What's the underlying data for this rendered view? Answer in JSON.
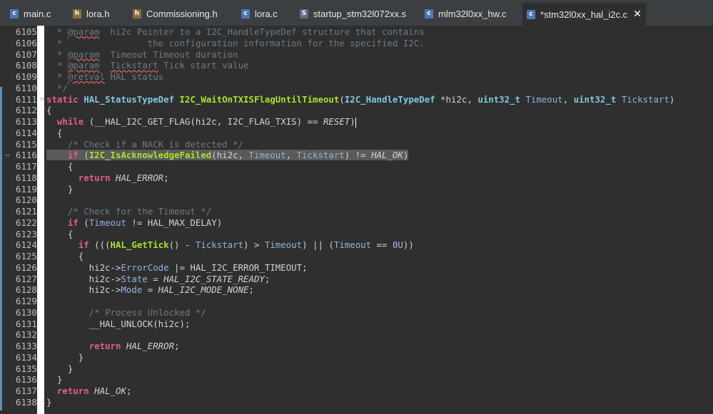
{
  "tabs": [
    {
      "label": "main.c",
      "icon": "c-file-icon",
      "kind": "c"
    },
    {
      "label": "lora.h",
      "icon": "h-file-icon",
      "kind": "h"
    },
    {
      "label": "Commissioning.h",
      "icon": "h-file-icon",
      "kind": "h"
    },
    {
      "label": "lora.c",
      "icon": "c-file-icon",
      "kind": "c"
    },
    {
      "label": "startup_stm32l072xx.s",
      "icon": "s-file-icon",
      "kind": "s"
    },
    {
      "label": "mlm32l0xx_hw.c",
      "icon": "c-file-icon",
      "kind": "c"
    },
    {
      "label": "*stm32l0xx_hal_i2c.c",
      "icon": "c-file-icon",
      "kind": "c",
      "active": true
    }
  ],
  "lines": [
    {
      "n": "6105",
      "t": "  * @param  hi2c Pointer to a I2C_HandleTypeDef structure that contains"
    },
    {
      "n": "6106",
      "t": "  *                the configuration information for the specified I2C."
    },
    {
      "n": "6107",
      "t": "  * @param  Timeout Timeout duration"
    },
    {
      "n": "6108",
      "t": "  * @param  Tickstart Tick start value"
    },
    {
      "n": "6109",
      "t": "  * @retval HAL status"
    },
    {
      "n": "6110",
      "t": "  */"
    },
    {
      "n": "6111",
      "t": "static HAL_StatusTypeDef I2C_WaitOnTXISFlagUntilTimeout(I2C_HandleTypeDef *hi2c, uint32_t Timeout, uint32_t Tickstart)"
    },
    {
      "n": "6112",
      "t": "{"
    },
    {
      "n": "6113",
      "t": "  while (__HAL_I2C_GET_FLAG(hi2c, I2C_FLAG_TXIS) == RESET)"
    },
    {
      "n": "6114",
      "t": "  {"
    },
    {
      "n": "6115",
      "t": "    /* Check if a NACK is detected */"
    },
    {
      "n": "6116",
      "t": "    if (I2C_IsAcknowledgeFailed(hi2c, Timeout, Tickstart) != HAL_OK)"
    },
    {
      "n": "6117",
      "t": "    {"
    },
    {
      "n": "6118",
      "t": "      return HAL_ERROR;"
    },
    {
      "n": "6119",
      "t": "    }"
    },
    {
      "n": "6120",
      "t": ""
    },
    {
      "n": "6121",
      "t": "    /* Check for the Timeout */"
    },
    {
      "n": "6122",
      "t": "    if (Timeout != HAL_MAX_DELAY)"
    },
    {
      "n": "6123",
      "t": "    {"
    },
    {
      "n": "6124",
      "t": "      if (((HAL_GetTick() - Tickstart) > Timeout) || (Timeout == 0U))"
    },
    {
      "n": "6125",
      "t": "      {"
    },
    {
      "n": "6126",
      "t": "        hi2c->ErrorCode |= HAL_I2C_ERROR_TIMEOUT;"
    },
    {
      "n": "6127",
      "t": "        hi2c->State = HAL_I2C_STATE_READY;"
    },
    {
      "n": "6128",
      "t": "        hi2c->Mode = HAL_I2C_MODE_NONE;"
    },
    {
      "n": "6129",
      "t": ""
    },
    {
      "n": "6130",
      "t": "        /* Process Unlocked */"
    },
    {
      "n": "6131",
      "t": "        __HAL_UNLOCK(hi2c);"
    },
    {
      "n": "6132",
      "t": ""
    },
    {
      "n": "6133",
      "t": "        return HAL_ERROR;"
    },
    {
      "n": "6134",
      "t": "      }"
    },
    {
      "n": "6135",
      "t": "    }"
    },
    {
      "n": "6136",
      "t": "  }"
    },
    {
      "n": "6137",
      "t": "  return HAL_OK;"
    },
    {
      "n": "6138",
      "t": "}"
    }
  ],
  "colors": {
    "background": "#2f2f2f",
    "keyword": "#e15f86",
    "type": "#7ec8e0",
    "function": "#a6e22e",
    "comment": "#6d7a86"
  }
}
